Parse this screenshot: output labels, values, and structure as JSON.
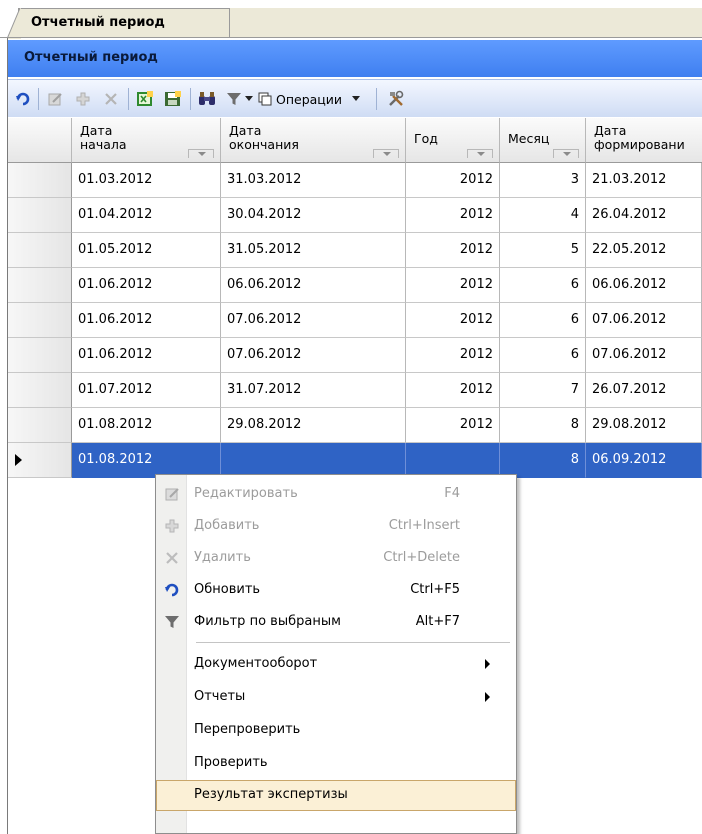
{
  "tab": {
    "title": "Отчетный период"
  },
  "panel": {
    "title": "Отчетный период"
  },
  "toolbar": {
    "operations_label": "Операции"
  },
  "icons": {
    "refresh": "refresh-icon",
    "edit": "edit-icon",
    "add": "add-icon",
    "delete": "delete-icon",
    "export_excel": "excel-icon",
    "save": "save-icon",
    "find": "binoculars-icon",
    "filter": "filter-icon",
    "operations": "operations-icon",
    "tools": "tools-icon"
  },
  "colors": {
    "header_blue": "#3f7ff0",
    "selection_blue": "#2f63c5",
    "menu_highlight": "#fbf0d6"
  },
  "grid": {
    "columns": [
      {
        "line1": "Дата",
        "line2": "начала"
      },
      {
        "line1": "Дата",
        "line2": "окончания"
      },
      {
        "line1": "Год",
        "line2": ""
      },
      {
        "line1": "Месяц",
        "line2": ""
      },
      {
        "line1": "Дата",
        "line2": "формировани"
      }
    ],
    "rows": [
      {
        "start": "01.03.2012",
        "end": "31.03.2012",
        "year": "2012",
        "month": "3",
        "created": "21.03.2012"
      },
      {
        "start": "01.04.2012",
        "end": "30.04.2012",
        "year": "2012",
        "month": "4",
        "created": "26.04.2012"
      },
      {
        "start": "01.05.2012",
        "end": "31.05.2012",
        "year": "2012",
        "month": "5",
        "created": "22.05.2012"
      },
      {
        "start": "01.06.2012",
        "end": "06.06.2012",
        "year": "2012",
        "month": "6",
        "created": "06.06.2012"
      },
      {
        "start": "01.06.2012",
        "end": "07.06.2012",
        "year": "2012",
        "month": "6",
        "created": "07.06.2012"
      },
      {
        "start": "01.06.2012",
        "end": "07.06.2012",
        "year": "2012",
        "month": "6",
        "created": "07.06.2012"
      },
      {
        "start": "01.07.2012",
        "end": "31.07.2012",
        "year": "2012",
        "month": "7",
        "created": "26.07.2012"
      },
      {
        "start": "01.08.2012",
        "end": "29.08.2012",
        "year": "2012",
        "month": "8",
        "created": "29.08.2012"
      },
      {
        "start": "01.08.2012",
        "end": "",
        "year": "",
        "month": "8",
        "created": "06.09.2012"
      }
    ]
  },
  "context_menu": {
    "items": [
      {
        "label": "Редактировать",
        "shortcut": "F4",
        "disabled": true,
        "icon": "edit-icon"
      },
      {
        "label": "Добавить",
        "shortcut": "Ctrl+Insert",
        "disabled": true,
        "icon": "add-icon"
      },
      {
        "label": "Удалить",
        "shortcut": "Ctrl+Delete",
        "disabled": true,
        "icon": "delete-icon"
      },
      {
        "label": "Обновить",
        "shortcut": "Ctrl+F5",
        "disabled": false,
        "icon": "refresh-icon"
      },
      {
        "label": "Фильтр по выбраным",
        "shortcut": "Alt+F7",
        "disabled": false,
        "icon": "filter-icon"
      },
      {
        "label": "Документооборот",
        "shortcut": "",
        "submenu": true
      },
      {
        "label": "Отчеты",
        "shortcut": "",
        "submenu": true
      },
      {
        "label": "Перепроверить",
        "shortcut": ""
      },
      {
        "label": "Проверить",
        "shortcut": ""
      },
      {
        "label": "Результат экспертизы",
        "shortcut": "",
        "highlighted": true
      }
    ]
  }
}
